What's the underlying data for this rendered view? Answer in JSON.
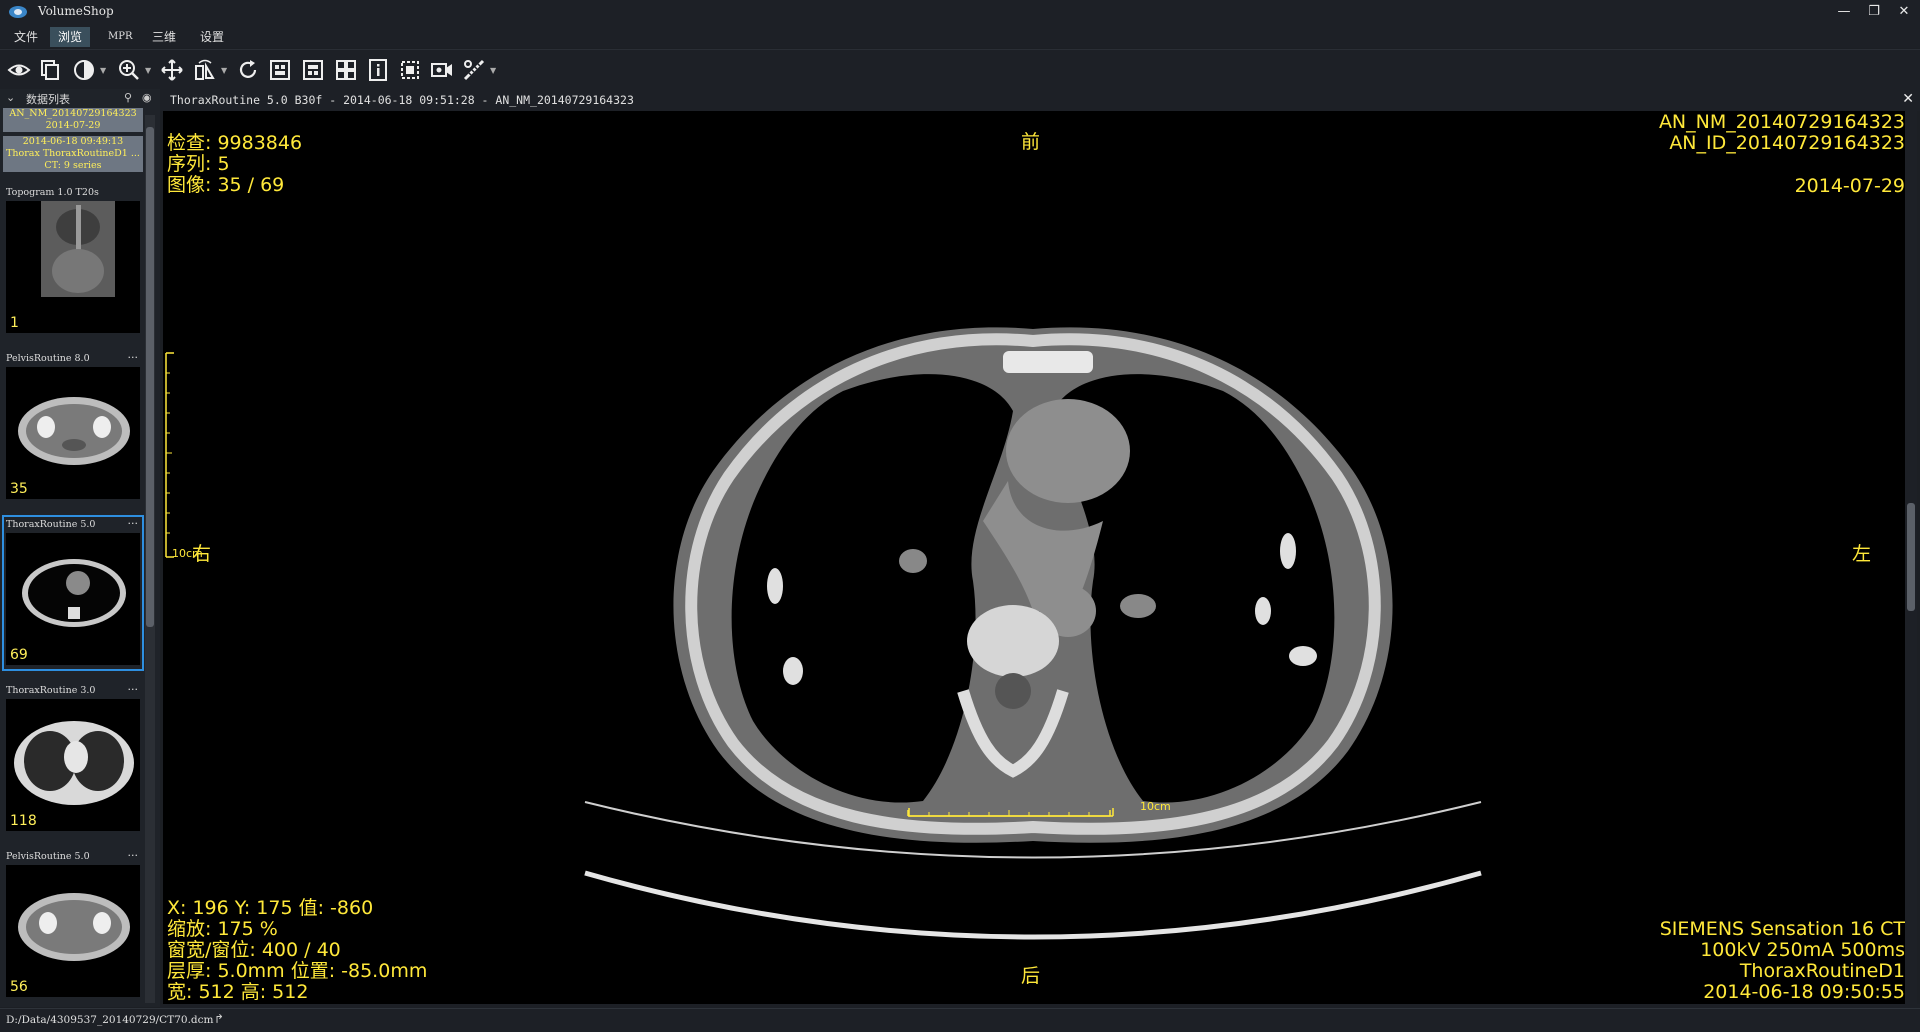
{
  "app": {
    "title": "VolumeShop"
  },
  "menu": [
    {
      "label": "文件"
    },
    {
      "label": "浏览"
    },
    {
      "label": "MPR"
    },
    {
      "label": "三维"
    },
    {
      "label": "设置"
    }
  ],
  "toolbar": {
    "icons": [
      "eye-icon",
      "stack-icon",
      "contrast-icon",
      "zoom-icon",
      "pan-icon",
      "flip-icon",
      "reset-icon",
      "layout-1-icon",
      "layout-2-icon",
      "layout-grid-icon",
      "info-icon",
      "crop-icon",
      "video-icon",
      "measure-tool-icon"
    ]
  },
  "sidebar": {
    "heading": "数据列表",
    "study": {
      "patient_name": "AN_NM_20140729164323",
      "date": "2014-07-29",
      "datetime": "2014-06-18 09:49:13",
      "description": "Thorax ThoraxRoutineD1 ...",
      "info": "CT: 9 series"
    },
    "series": [
      {
        "label": "Topogram  1.0  T20s",
        "count": "1",
        "more": ""
      },
      {
        "label": "PelvisRoutine  8.0",
        "count": "35",
        "more": "···"
      },
      {
        "label": "ThoraxRoutine  5.0",
        "count": "69",
        "more": "···"
      },
      {
        "label": "ThoraxRoutine  3.0",
        "count": "118",
        "more": "···"
      },
      {
        "label": "PelvisRoutine  5.0",
        "count": "56",
        "more": "···"
      }
    ]
  },
  "viewer": {
    "title": "ThoraxRoutine  5.0  B30f - 2014-06-18 09:51:28 - AN_NM_20140729164323",
    "top_left": [
      "检查: 9983846",
      "序列: 5",
      "图像: 35 / 69"
    ],
    "top_right": [
      "AN_NM_20140729164323",
      "AN_ID_20140729164323",
      "2014-07-29"
    ],
    "bottom_left": [
      "X: 196  Y: 175  值: -860",
      "缩放: 175 %",
      "窗宽/窗位: 400 / 40",
      "层厚: 5.0mm  位置: -85.0mm",
      "宽: 512  高: 512"
    ],
    "bottom_right": [
      "SIEMENS  Sensation 16  CT",
      "100kV  250mA  500ms",
      "ThoraxRoutineD1",
      "2014-06-18 09:50:55"
    ],
    "orientation": {
      "top": "前",
      "bottom": "后",
      "left": "右",
      "right": "左"
    },
    "scale_label_v": "10cm",
    "scale_label_h": "10cm",
    "overlay_color": "#ffe83a"
  },
  "status": {
    "path": "D:/Data/4309537_20140729/CT70.dcm"
  }
}
